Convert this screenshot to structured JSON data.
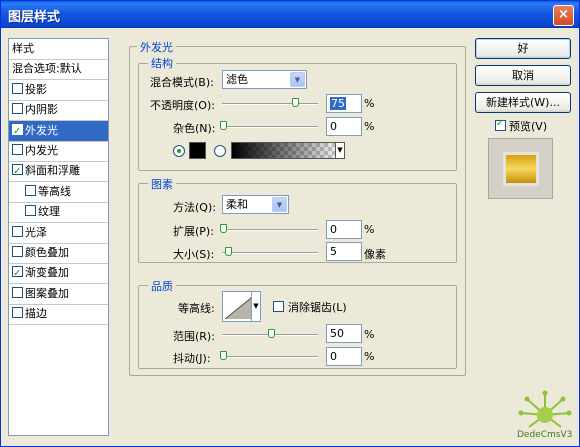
{
  "window": {
    "title": "图层样式",
    "close": "×"
  },
  "left_panel": {
    "items": [
      {
        "label": "样式",
        "checkbox": false,
        "checked": false,
        "selected": false
      },
      {
        "label": "混合选项:默认",
        "checkbox": false,
        "checked": false,
        "selected": false
      },
      {
        "label": "投影",
        "checkbox": true,
        "checked": false,
        "selected": false
      },
      {
        "label": "内阴影",
        "checkbox": true,
        "checked": false,
        "selected": false
      },
      {
        "label": "外发光",
        "checkbox": true,
        "checked": true,
        "selected": true
      },
      {
        "label": "内发光",
        "checkbox": true,
        "checked": false,
        "selected": false
      },
      {
        "label": "斜面和浮雕",
        "checkbox": true,
        "checked": true,
        "selected": false
      },
      {
        "label": "等高线",
        "checkbox": true,
        "checked": false,
        "selected": false
      },
      {
        "label": "纹理",
        "checkbox": true,
        "checked": false,
        "selected": false
      },
      {
        "label": "光泽",
        "checkbox": true,
        "checked": false,
        "selected": false
      },
      {
        "label": "颜色叠加",
        "checkbox": true,
        "checked": false,
        "selected": false
      },
      {
        "label": "渐变叠加",
        "checkbox": true,
        "checked": true,
        "selected": false
      },
      {
        "label": "图案叠加",
        "checkbox": true,
        "checked": false,
        "selected": false
      },
      {
        "label": "描边",
        "checkbox": true,
        "checked": false,
        "selected": false
      }
    ]
  },
  "outer_glow": {
    "title": "外发光",
    "structure": {
      "title": "结构",
      "blend_mode_label": "混合模式(B):",
      "blend_mode_value": "滤色",
      "opacity_label": "不透明度(O):",
      "opacity_value": "75",
      "noise_label": "杂色(N):",
      "noise_value": "0",
      "percent": "%"
    },
    "elements": {
      "title": "图素",
      "technique_label": "方法(Q):",
      "technique_value": "柔和",
      "spread_label": "扩展(P):",
      "spread_value": "0",
      "size_label": "大小(S):",
      "size_value": "5",
      "size_unit": "像素",
      "percent": "%"
    },
    "quality": {
      "title": "品质",
      "contour_label": "等高线:",
      "antialias_label": "消除锯齿(L)",
      "range_label": "范围(R):",
      "range_value": "50",
      "jitter_label": "抖动(J):",
      "jitter_value": "0",
      "percent": "%"
    }
  },
  "sliders": {
    "opacity": 0.75,
    "noise": 0,
    "spread": 0,
    "size": 0.05,
    "range": 0.5,
    "jitter": 0
  },
  "buttons": {
    "ok": "好",
    "cancel": "取消",
    "new_style": "新建样式(W)...",
    "preview_label": "预览(V)"
  },
  "watermark": {
    "text": "DedeCmsV3"
  },
  "colors": {
    "accent": "#316ac5",
    "title_bar": "#0a46d0",
    "group_title": "#0046d5",
    "glow_color": "#000000"
  }
}
